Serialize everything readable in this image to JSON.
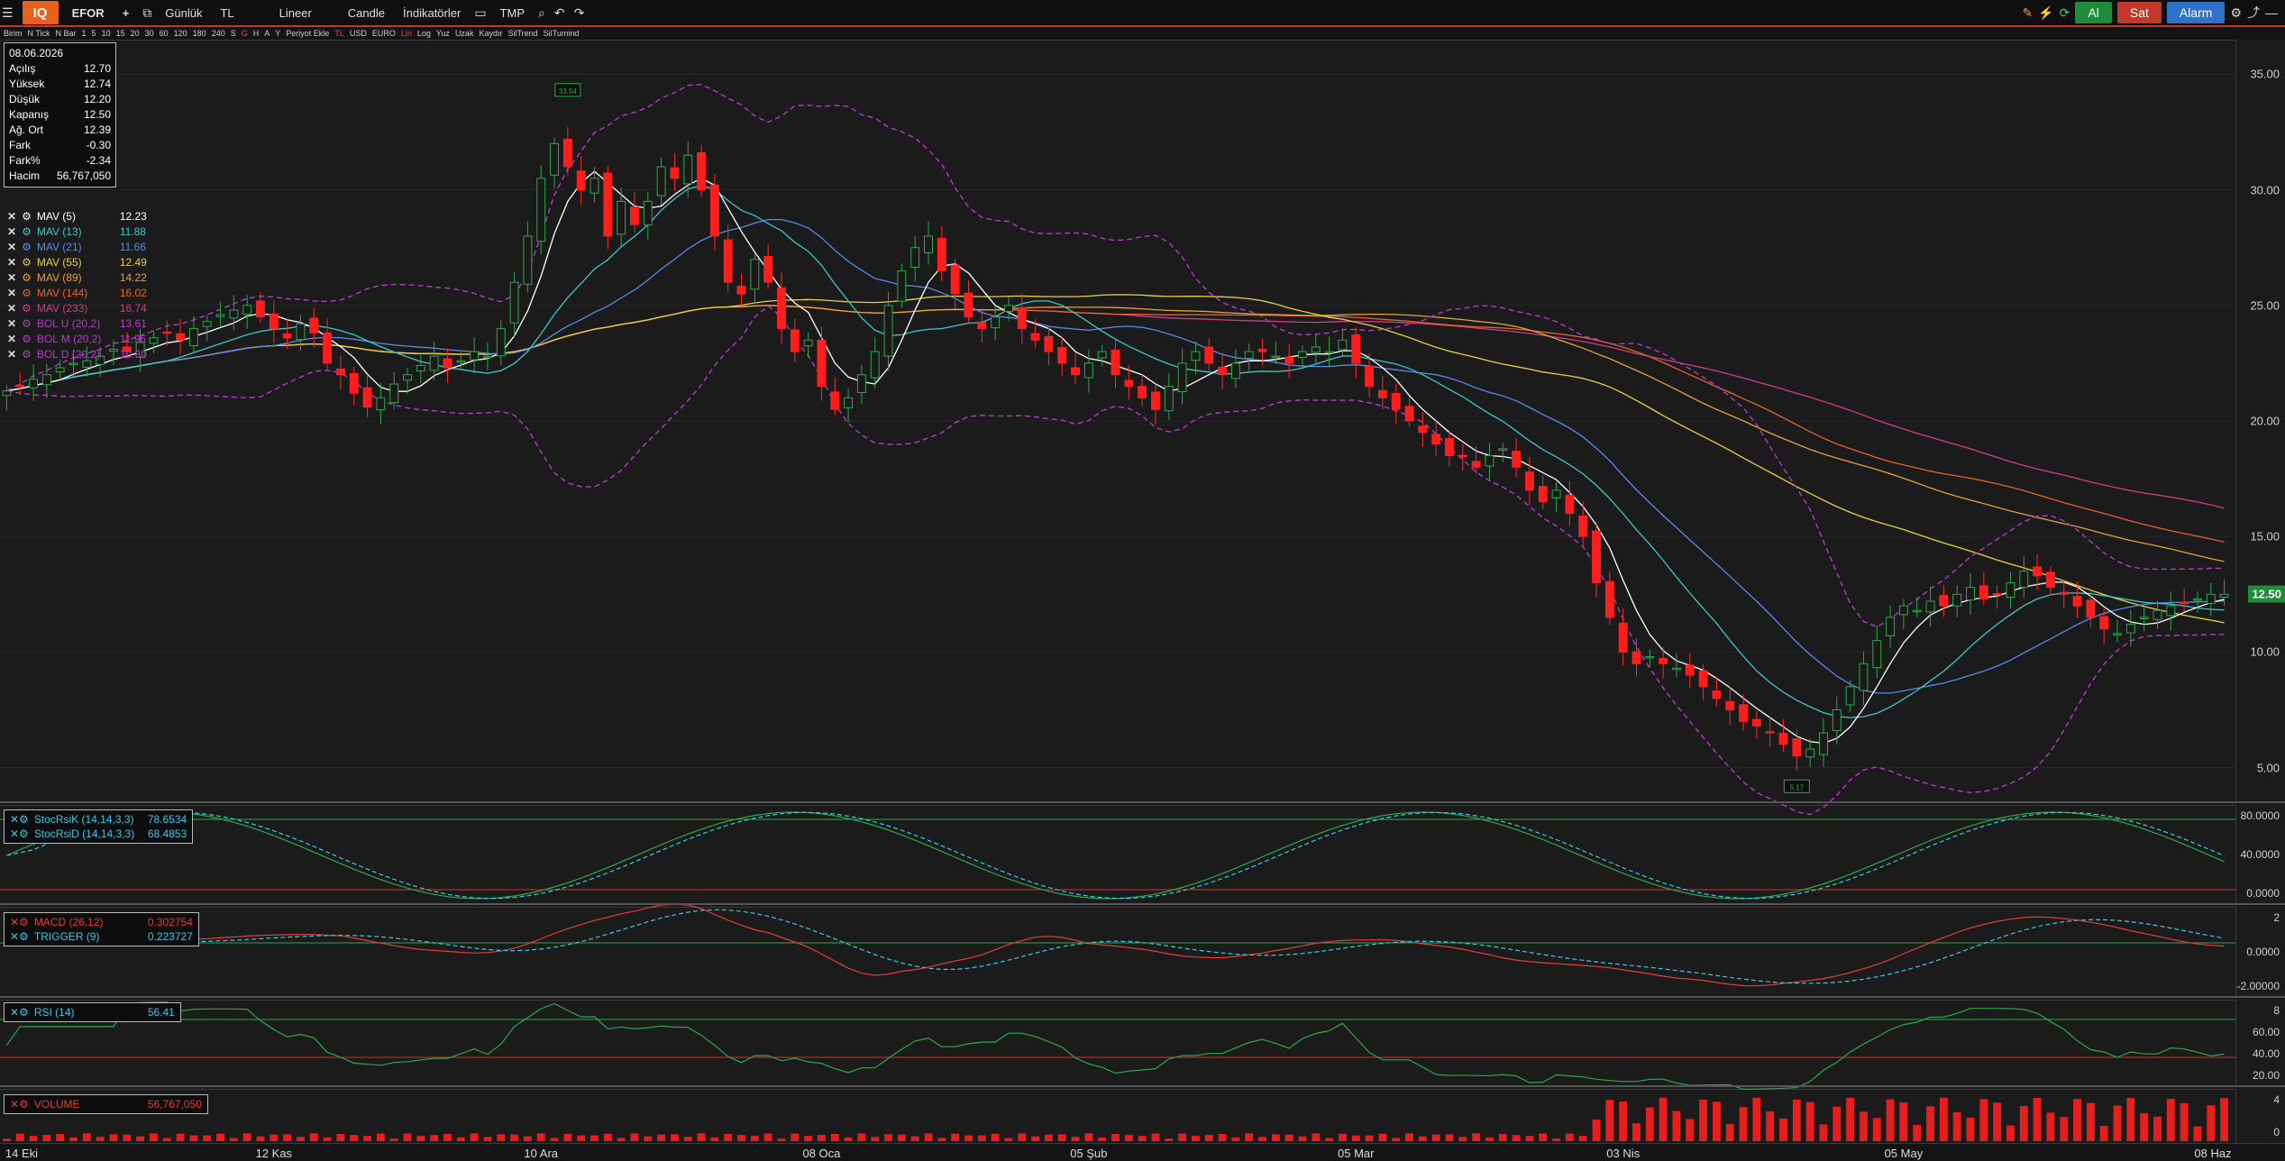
{
  "toolbar": {
    "logo": "IQ",
    "symbol": "EFOR",
    "add": "+",
    "period": "Günlük",
    "currency": "TL",
    "scale": "Lineer",
    "chart_type": "Candle",
    "indicators": "İndikatörler",
    "tmp": "TMP",
    "buy": "Al",
    "sell": "Sat",
    "alarm": "Alarm"
  },
  "toolbar2": {
    "items": [
      "Birim",
      "N Tick",
      "N Bar",
      "1",
      "5",
      "10",
      "15",
      "20",
      "30",
      "60",
      "120",
      "180",
      "240",
      "S",
      "G",
      "H",
      "A",
      "Y",
      "Periyot Ekle",
      "TL",
      "USD",
      "EURO",
      "Lin",
      "Log",
      "Yuz",
      "Uzak",
      "Kaydır",
      "SilTrend",
      "SilTumind"
    ]
  },
  "ohlc": {
    "date": "08.06.2026",
    "rows": [
      {
        "label": "Açılış",
        "value": "12.70"
      },
      {
        "label": "Yüksek",
        "value": "12.74"
      },
      {
        "label": "Düşük",
        "value": "12.20"
      },
      {
        "label": "Kapanış",
        "value": "12.50"
      },
      {
        "label": "Ağ. Ort",
        "value": "12.39"
      },
      {
        "label": "Fark",
        "value": "-0.30"
      },
      {
        "label": "Fark%",
        "value": "-2.34"
      },
      {
        "label": "Hacim",
        "value": "56,767,050"
      }
    ]
  },
  "legend": [
    {
      "name": "MAV (5)",
      "value": "12.23",
      "color": "#ffffff"
    },
    {
      "name": "MAV (13)",
      "value": "11.88",
      "color": "#3cc8c8"
    },
    {
      "name": "MAV (21)",
      "value": "11.66",
      "color": "#5a8ae6"
    },
    {
      "name": "MAV (55)",
      "value": "12.49",
      "color": "#e6d23c"
    },
    {
      "name": "MAV (89)",
      "value": "14.22",
      "color": "#e6a03c"
    },
    {
      "name": "MAV (144)",
      "value": "16.02",
      "color": "#e6642d"
    },
    {
      "name": "MAV (233)",
      "value": "16.74",
      "color": "#d23c8c"
    },
    {
      "name": "BOL U (20,2)",
      "value": "13.61",
      "color": "#b43cc8"
    },
    {
      "name": "BOL M (20,2)",
      "value": "11.96",
      "color": "#b43cc8"
    },
    {
      "name": "BOL D (20,2)",
      "value": "10.30",
      "color": "#b43cc8"
    }
  ],
  "price_axis": {
    "labels": [
      "35.00",
      "30.00",
      "25.00",
      "20.00",
      "15.00",
      "10.00",
      "5.00"
    ],
    "last_price": "12.50",
    "annotations": {
      "high": "33.54",
      "low": "5.17"
    }
  },
  "stoch": {
    "rows": [
      {
        "name": "StocRsiK (14,14,3,3)",
        "value": "78.6534"
      },
      {
        "name": "StocRsiD (14,14,3,3)",
        "value": "68.4853"
      }
    ],
    "axis": [
      "80.0000",
      "40.0000",
      "0.0000"
    ]
  },
  "macd": {
    "rows": [
      {
        "name": "MACD (26,12)",
        "value": "0.302754"
      },
      {
        "name": "TRIGGER (9)",
        "value": "0.223727"
      }
    ],
    "axis": [
      "2",
      "0.0000",
      "-2.00000"
    ]
  },
  "rsi": {
    "rows": [
      {
        "name": "RSI (14)",
        "value": "56.41"
      }
    ],
    "axis": [
      "8",
      "60.00",
      "40.00",
      "20.00"
    ]
  },
  "volume": {
    "rows": [
      {
        "name": "VOLUME",
        "value": "56,767,050"
      }
    ],
    "axis": [
      "4",
      "0"
    ]
  },
  "xaxis": {
    "labels": [
      "14 Eki",
      "12 Kas",
      "10 Ara",
      "08 Oca",
      "05 Şub",
      "05 Mar",
      "03 Nis",
      "05 May",
      "08 Haz"
    ]
  },
  "chart_data": {
    "type": "candlestick",
    "symbol": "EFOR",
    "ylim": [
      3.5,
      36.5
    ],
    "closes": [
      21.3,
      21.5,
      21.8,
      22.0,
      22.3,
      22.5,
      22.6,
      22.8,
      23.1,
      23.0,
      23.4,
      23.6,
      23.8,
      23.5,
      24.0,
      24.3,
      24.6,
      24.8,
      25.0,
      24.5,
      24.0,
      23.6,
      24.2,
      23.8,
      22.5,
      22.0,
      21.2,
      20.6,
      21.0,
      21.6,
      22.0,
      22.4,
      22.8,
      22.3,
      22.6,
      23.0,
      22.8,
      24.0,
      26.0,
      28.0,
      30.5,
      32.0,
      31.0,
      30.0,
      30.5,
      28.0,
      29.5,
      28.5,
      29.5,
      31.0,
      30.5,
      31.5,
      30.0,
      28.0,
      26.0,
      25.5,
      27.0,
      26.0,
      24.0,
      23.0,
      23.5,
      21.5,
      20.5,
      21.0,
      22.0,
      23.0,
      25.0,
      26.5,
      27.5,
      28.0,
      26.5,
      25.5,
      24.5,
      24.0,
      24.5,
      25.0,
      24.0,
      23.5,
      23.0,
      22.5,
      22.0,
      22.5,
      23.0,
      22.0,
      21.5,
      21.0,
      20.5,
      21.5,
      22.5,
      23.0,
      22.5,
      22.0,
      22.5,
      23.0,
      23.0,
      22.8,
      22.5,
      23.0,
      23.2,
      23.0,
      23.5,
      22.5,
      21.5,
      21.0,
      20.5,
      20.0,
      19.5,
      19.0,
      18.5,
      18.5,
      18.0,
      18.5,
      18.8,
      18.0,
      17.0,
      16.5,
      17.0,
      16.0,
      15.0,
      13.0,
      11.5,
      10.0,
      9.5,
      9.8,
      9.5,
      9.3,
      9.0,
      8.5,
      8.0,
      7.5,
      7.0,
      6.8,
      6.5,
      6.0,
      5.5,
      5.8,
      6.5,
      7.5,
      8.5,
      9.5,
      10.5,
      11.5,
      12.0,
      11.8,
      12.2,
      12.0,
      12.5,
      12.8,
      12.3,
      12.5,
      13.0,
      13.5,
      13.3,
      12.8,
      12.5,
      12.0,
      11.5,
      11.0,
      10.8,
      11.2,
      11.5,
      11.8,
      12.0,
      12.1,
      12.3,
      12.5,
      12.5
    ],
    "ma": {
      "MAV (5)": "white",
      "MAV (13)": "teal",
      "MAV (21)": "blue",
      "MAV (55)": "yellow",
      "MAV (89)": "orange",
      "MAV (144)": "orange-red",
      "MAV (233)": "magenta"
    },
    "bollinger": "dashed purple",
    "colors": {
      "up": "#1e8c3a",
      "down": "#ff1e1e",
      "wick": "#cccccc"
    }
  }
}
